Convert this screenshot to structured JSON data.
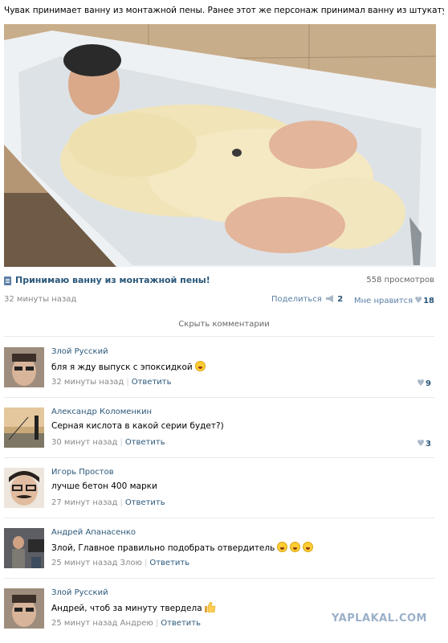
{
  "caption": "Чувак принимает ванну из монтажной пены. Ранее этот же персонаж принимал ванну из штукатурки.",
  "video": {
    "title": "Принимаю ванну из монтажной пены!",
    "views": "558 просмотров",
    "posted": "32 минуты назад",
    "share_label": "Поделиться",
    "share_count": "2",
    "like_label": "Мне нравится",
    "like_count": "18"
  },
  "hide_comments": "Скрыть комментарии",
  "comments": [
    {
      "author": "Злой Русский",
      "text": "бля я жду выпуск с эпоксидкой",
      "time": "32 минуты назад",
      "reply": "Ответить",
      "likes": "9",
      "icon": "laughing-emoji"
    },
    {
      "author": "Александр Коломенкин",
      "text": "Серная кислота в какой серии будет?)",
      "time": "30 минут назад",
      "reply": "Ответить",
      "likes": "3"
    },
    {
      "author": "Игорь Простов",
      "text": "лучше бетон 400 марки",
      "time": "27 минут назад",
      "reply": "Ответить"
    },
    {
      "author": "Андрей Апанасенко",
      "text": "Злой, Главное правильно подобрать отвердитель",
      "time": "25 минут назад Злою",
      "reply": "Ответить",
      "icon": "laughing-emoji"
    },
    {
      "author": "Злой Русский",
      "text": "Андрей, чтоб за минуту твердела",
      "time": "25 минут назад Андрею",
      "reply": "Ответить",
      "icon": "thumbs-up-emoji"
    }
  ],
  "watermark": "YAPLAKAL.COM",
  "colors": {
    "link": "#2b587a",
    "muted": "#888888",
    "divider": "#e6e9ee"
  }
}
